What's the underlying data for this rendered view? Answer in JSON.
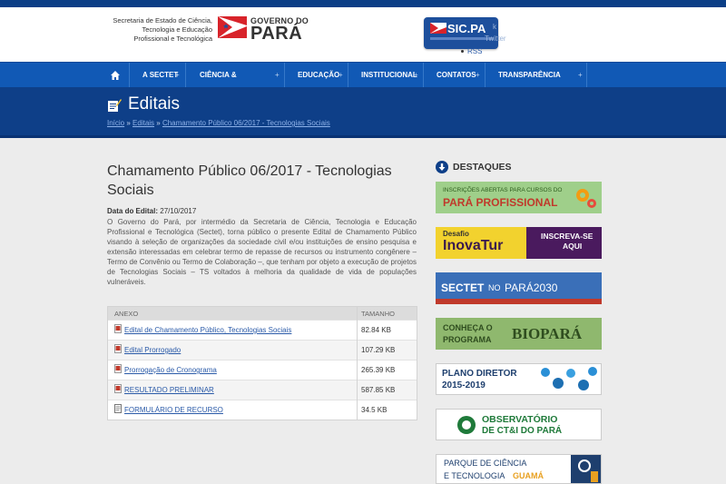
{
  "header": {
    "secretaria": [
      "Secretaria de Estado de Ciência,",
      "Tecnologia e Educação",
      "Profissional e Tecnológica"
    ],
    "gov_small": "GOVERNO DO",
    "gov_big": "PARÁ",
    "sicpa_label": "SIC.PA",
    "rss_label": "RSS",
    "ghost_1": "k",
    "ghost_2": "Twitter"
  },
  "nav": {
    "items": [
      {
        "label": "A SECTET"
      },
      {
        "label": "CIÊNCIA & TECNOLOGIA"
      },
      {
        "label": "EDUCAÇÃO"
      },
      {
        "label": "INSTITUCIONAL"
      },
      {
        "label": "CONTATOS"
      },
      {
        "label": "TRANSPARÊNCIA PÚBLICA"
      }
    ],
    "plus": "+"
  },
  "banner": {
    "title": "Editais",
    "breadcrumb": {
      "home": "Início",
      "sep": " » ",
      "section": "Editais",
      "current": "Chamamento Público 06/2017 - Tecnologias Sociais"
    }
  },
  "article": {
    "title": "Chamamento Público 06/2017 - Tecnologias Sociais",
    "date_label": "Data do Edital:",
    "date_value": "27/10/2017",
    "body": "O Governo do Pará, por intermédio da Secretaria de Ciência, Tecnologia e Educação Profissional e Tecnológica (Sectet), torna público o presente Edital de Chamamento Público visando à seleção de organizações da sociedade civil e/ou instituições de ensino pesquisa e extensão interessadas em celebrar termo de repasse de recursos ou instrumento congênere – Termo de Convênio ou Termo de Colaboração –, que tenham por objeto a execução de projetos de Tecnologias Sociais – TS voltados à melhoria da qualidade de vida de populações vulneráveis."
  },
  "attachments": {
    "col_anexo": "ANEXO",
    "col_tamanho": "TAMANHO",
    "rows": [
      {
        "name": "Edital de Chamamento Público, Tecnologias Sociais",
        "size": "82.84 KB",
        "icon": "pdf-icon"
      },
      {
        "name": "Edital Prorrogado",
        "size": "107.29 KB",
        "icon": "pdf-icon"
      },
      {
        "name": "Prorrogação de Cronograma",
        "size": "265.39 KB",
        "icon": "pdf-icon"
      },
      {
        "name": "RESULTADO PRELIMINAR",
        "size": "587.85 KB",
        "icon": "pdf-icon"
      },
      {
        "name": "FORMULÁRIO DE RECURSO",
        "size": "34.5 KB",
        "icon": "doc-icon"
      }
    ]
  },
  "sidebar": {
    "title": "DESTAQUES",
    "promos": [
      {
        "line1": "INSCRIÇÕES ABERTAS PARA CURSOS DO",
        "line2": "PARÁ PROFISSIONAL"
      },
      {
        "line1": "Desafio",
        "line2": "InovaTur",
        "line3": "INSCREVA-SE",
        "line4": "AQUI"
      },
      {
        "line1": "SECTET",
        "line2": "NO",
        "line3": "PARÁ2030"
      },
      {
        "line1": "CONHEÇA O",
        "line2": "PROGRAMA",
        "line3": "BIOPARÁ"
      },
      {
        "line1": "PLANO DIRETOR",
        "line2": "2015-2019"
      },
      {
        "line1": "OBSERVATÓRIO",
        "line2": "DE CT&I DO PARÁ"
      },
      {
        "line1": "PARQUE DE CIÊNCIA",
        "line2": "E TECNOLOGIA",
        "line3": "GUAMÁ"
      }
    ]
  },
  "colors": {
    "nav_blue": "#1159b5",
    "banner_blue": "#0e3f88",
    "link": "#2a5aa8",
    "pdf_red": "#c0392b"
  }
}
